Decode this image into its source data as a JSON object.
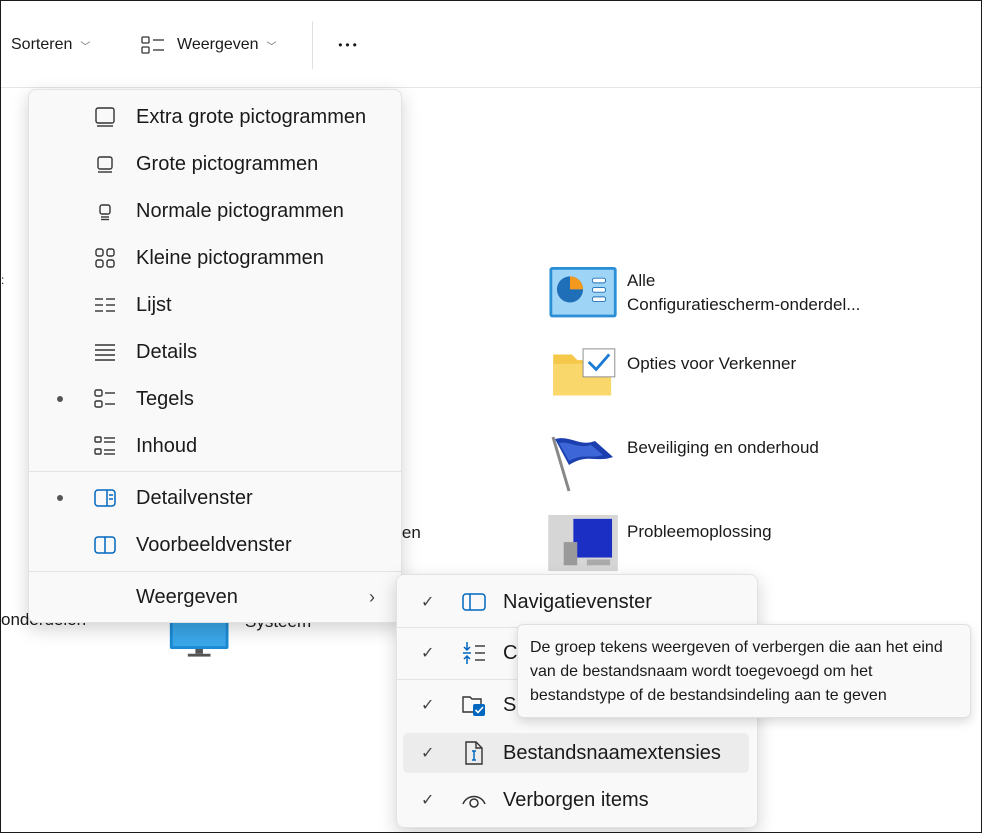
{
  "toolbar": {
    "sort_label": "Sorteren",
    "view_label": "Weergeven",
    "more_label": "•••"
  },
  "content": {
    "left_fragment_1": "ngen",
    "left_fragment_2": "onderdelen",
    "left_fragment_3": "Systeem",
    "items": [
      {
        "line1": "Alle",
        "line2": "Configuratiescherm-onderdel..."
      },
      {
        "line1": "Opties voor Verkenner"
      },
      {
        "line1": "Beveiliging en onderhoud"
      },
      {
        "line1": "Probleemoplossing"
      }
    ]
  },
  "view_menu": {
    "items": [
      {
        "label": "Extra grote pictogrammen",
        "icon": "monitor-xl-icon"
      },
      {
        "label": "Grote pictogrammen",
        "icon": "monitor-large-icon"
      },
      {
        "label": "Normale pictogrammen",
        "icon": "monitor-medium-icon"
      },
      {
        "label": "Kleine pictogrammen",
        "icon": "small-icons-grid-icon"
      },
      {
        "label": "Lijst",
        "icon": "list-icon"
      },
      {
        "label": "Details",
        "icon": "details-icon"
      },
      {
        "label": "Tegels",
        "icon": "tiles-icon",
        "selected": true
      },
      {
        "label": "Inhoud",
        "icon": "content-icon"
      },
      {
        "label": "Detailvenster",
        "icon": "details-pane-icon",
        "selected": true
      },
      {
        "label": "Voorbeeldvenster",
        "icon": "preview-pane-icon"
      },
      {
        "label": "Weergeven",
        "icon": "",
        "submenu": true
      }
    ],
    "submenu_arrow": "›"
  },
  "show_submenu": {
    "items": [
      {
        "label": "Navigatievenster",
        "checked": true,
        "icon": "navigation-pane-icon"
      },
      {
        "label": "C",
        "checked": true,
        "icon": "compact-view-icon"
      },
      {
        "label": "Se",
        "checked": true,
        "icon": "item-checkboxes-icon"
      },
      {
        "label": "Bestandsnaamextensies",
        "checked": true,
        "icon": "file-extension-icon",
        "hover": true
      },
      {
        "label": "Verborgen items",
        "checked": true,
        "icon": "eye-icon"
      }
    ],
    "check_glyph": "✓"
  },
  "tooltip": {
    "text": "De groep tekens weergeven of verbergen die aan het eind van de bestandsnaam wordt toegevoegd om het bestandstype of de bestandsindeling aan te geven"
  },
  "colors": {
    "accent": "#0067c0",
    "menu_bg": "#f9f9f9",
    "hover_bg": "#ececec"
  }
}
